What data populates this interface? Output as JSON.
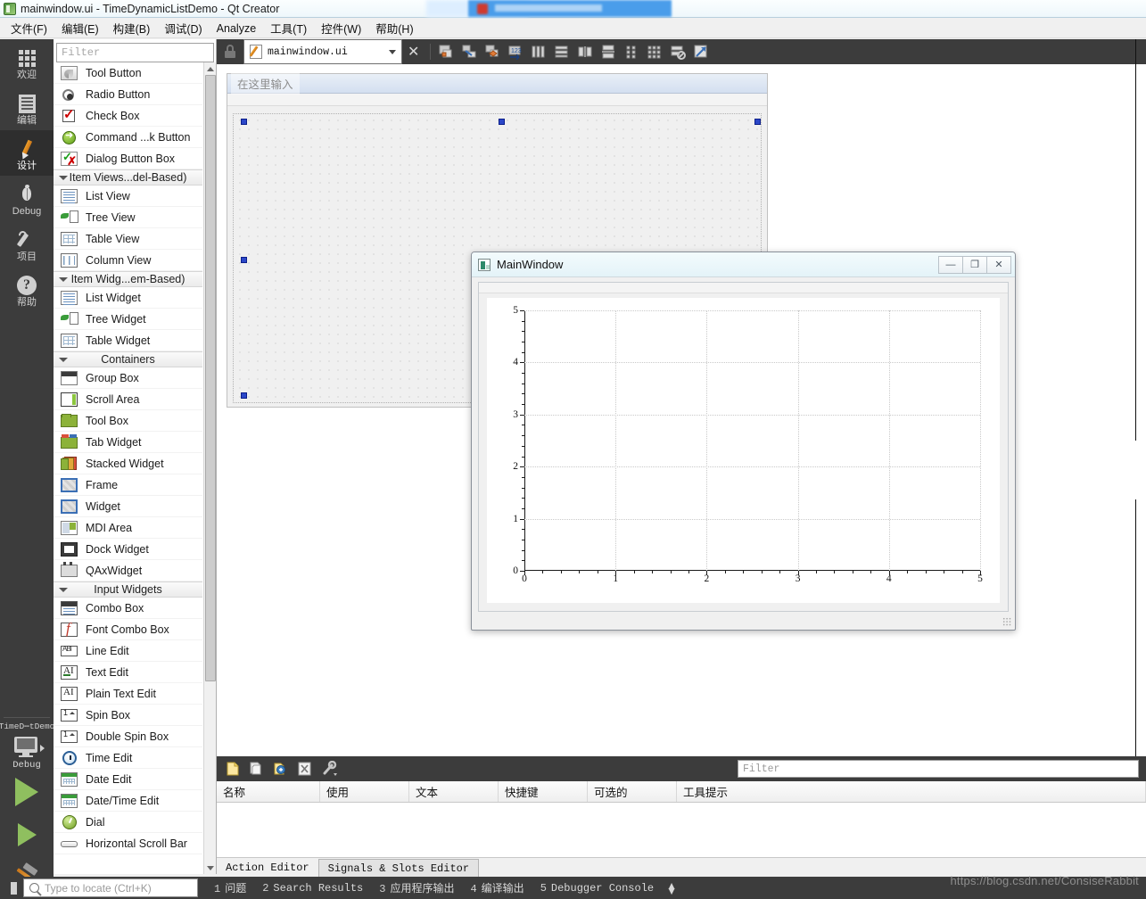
{
  "window": {
    "title": "mainwindow.ui - TimeDynamicListDemo - Qt Creator",
    "icon": "qtcreator-icon"
  },
  "menubar": {
    "items": [
      {
        "label": "文件(F)",
        "name": "menu-file"
      },
      {
        "label": "编辑(E)",
        "name": "menu-edit"
      },
      {
        "label": "构建(B)",
        "name": "menu-build"
      },
      {
        "label": "调试(D)",
        "name": "menu-debug"
      },
      {
        "label": "Analyze",
        "name": "menu-analyze"
      },
      {
        "label": "工具(T)",
        "name": "menu-tools"
      },
      {
        "label": "控件(W)",
        "name": "menu-window"
      },
      {
        "label": "帮助(H)",
        "name": "menu-help"
      }
    ]
  },
  "modebar": {
    "modes": [
      {
        "label": "欢迎",
        "icon": "grid-icon",
        "active": false
      },
      {
        "label": "编辑",
        "icon": "document-icon",
        "active": false
      },
      {
        "label": "设计",
        "icon": "pencil-icon",
        "active": true
      },
      {
        "label": "Debug",
        "icon": "bug-icon",
        "active": false
      },
      {
        "label": "项目",
        "icon": "wrench-icon",
        "active": false
      },
      {
        "label": "帮助",
        "icon": "question-icon",
        "active": false
      }
    ],
    "kit": {
      "project": "TimeD⋯tDemo",
      "build_config": "Debug",
      "icon": "monitor-icon"
    },
    "run_button": "run-icon",
    "debug_button": "debug-run-icon",
    "build_button": "hammer-icon"
  },
  "widget_box": {
    "filter_placeholder": "Filter",
    "groups": [
      {
        "items": [
          {
            "label": "Tool Button",
            "icon": "tool-button-icon"
          },
          {
            "label": "Radio Button",
            "icon": "radio-button-icon"
          },
          {
            "label": "Check Box",
            "icon": "check-box-icon"
          },
          {
            "label": "Command ...k Button",
            "icon": "command-link-button-icon"
          },
          {
            "label": "Dialog Button Box",
            "icon": "dialog-button-box-icon"
          }
        ]
      },
      {
        "title": "Item Views...del-Based)",
        "items": [
          {
            "label": "List View",
            "icon": "list-view-icon"
          },
          {
            "label": "Tree View",
            "icon": "tree-view-icon"
          },
          {
            "label": "Table View",
            "icon": "table-view-icon"
          },
          {
            "label": "Column View",
            "icon": "column-view-icon"
          }
        ]
      },
      {
        "title": "Item Widg...em-Based)",
        "items": [
          {
            "label": "List Widget",
            "icon": "list-widget-icon"
          },
          {
            "label": "Tree Widget",
            "icon": "tree-widget-icon"
          },
          {
            "label": "Table Widget",
            "icon": "table-widget-icon"
          }
        ]
      },
      {
        "title": "Containers",
        "items": [
          {
            "label": "Group Box",
            "icon": "group-box-icon"
          },
          {
            "label": "Scroll Area",
            "icon": "scroll-area-icon"
          },
          {
            "label": "Tool Box",
            "icon": "tool-box-icon"
          },
          {
            "label": "Tab Widget",
            "icon": "tab-widget-icon"
          },
          {
            "label": "Stacked Widget",
            "icon": "stacked-widget-icon"
          },
          {
            "label": "Frame",
            "icon": "frame-icon"
          },
          {
            "label": "Widget",
            "icon": "widget-icon"
          },
          {
            "label": "MDI Area",
            "icon": "mdi-area-icon"
          },
          {
            "label": "Dock Widget",
            "icon": "dock-widget-icon"
          },
          {
            "label": "QAxWidget",
            "icon": "qax-widget-icon"
          }
        ]
      },
      {
        "title": "Input Widgets",
        "items": [
          {
            "label": "Combo Box",
            "icon": "combo-box-icon"
          },
          {
            "label": "Font Combo Box",
            "icon": "font-combo-box-icon"
          },
          {
            "label": "Line Edit",
            "icon": "line-edit-icon"
          },
          {
            "label": "Text Edit",
            "icon": "text-edit-icon"
          },
          {
            "label": "Plain Text Edit",
            "icon": "plain-text-edit-icon"
          },
          {
            "label": "Spin Box",
            "icon": "spin-box-icon"
          },
          {
            "label": "Double Spin Box",
            "icon": "double-spin-box-icon"
          },
          {
            "label": "Time Edit",
            "icon": "time-edit-icon"
          },
          {
            "label": "Date Edit",
            "icon": "date-edit-icon"
          },
          {
            "label": "Date/Time Edit",
            "icon": "date-time-edit-icon"
          },
          {
            "label": "Dial",
            "icon": "dial-icon"
          },
          {
            "label": "Horizontal Scroll Bar",
            "icon": "horizontal-scroll-bar-icon"
          }
        ]
      }
    ]
  },
  "designer_toolbar": {
    "open_file": "mainwindow.ui",
    "close_label": "✕",
    "buttons": [
      {
        "name": "edit-widgets-icon"
      },
      {
        "name": "edit-signals-slots-icon"
      },
      {
        "name": "edit-buddies-icon"
      },
      {
        "name": "edit-tab-order-icon"
      },
      {
        "name": "layout-horizontally-icon"
      },
      {
        "name": "layout-vertically-icon"
      },
      {
        "name": "layout-horizontally-splitter-icon"
      },
      {
        "name": "layout-vertically-splitter-icon"
      },
      {
        "name": "layout-in-form-icon"
      },
      {
        "name": "layout-grid-icon"
      },
      {
        "name": "break-layout-icon"
      },
      {
        "name": "adjust-size-icon"
      }
    ]
  },
  "form_editor": {
    "menubar_placeholder": "在这里输入"
  },
  "preview_window": {
    "title": "MainWindow",
    "buttons": [
      {
        "label": "—",
        "name": "minimize-button"
      },
      {
        "label": "❐",
        "name": "maximize-button"
      },
      {
        "label": "✕",
        "name": "close-button"
      }
    ]
  },
  "chart_data": {
    "type": "line",
    "title": "",
    "xlabel": "",
    "ylabel": "",
    "xlim": [
      0,
      5
    ],
    "ylim": [
      0,
      5
    ],
    "xticks": [
      0,
      1,
      2,
      3,
      4,
      5
    ],
    "yticks": [
      0,
      1,
      2,
      3,
      4,
      5
    ],
    "xtick_labels": [
      "0",
      "1",
      "2",
      "3",
      "4",
      "5"
    ],
    "ytick_labels": [
      "0",
      "1",
      "2",
      "3",
      "4",
      "5"
    ],
    "grid": true,
    "grid_style": "dotted",
    "legend": null,
    "series": [
      {
        "name": "",
        "x": [],
        "y": []
      }
    ],
    "note": "empty QCustomPlot / chart canvas - no data plotted"
  },
  "action_editor": {
    "filter_placeholder": "Filter",
    "toolbar_buttons": [
      {
        "name": "new-action-icon"
      },
      {
        "name": "copy-action-icon"
      },
      {
        "name": "edit-action-icon"
      },
      {
        "name": "delete-action-icon"
      },
      {
        "name": "configure-icon"
      }
    ],
    "columns": [
      "名称",
      "使用",
      "文本",
      "快捷键",
      "可选的",
      "工具提示"
    ],
    "rows": []
  },
  "bottom_tabs": [
    {
      "label": "Action Editor",
      "active": false
    },
    {
      "label": "Signals & Slots Editor",
      "active": true
    }
  ],
  "statusbar": {
    "locator_placeholder": "Type to locate (Ctrl+K)",
    "output_tabs": [
      {
        "num": "1",
        "label": "问题"
      },
      {
        "num": "2",
        "label": "Search Results"
      },
      {
        "num": "3",
        "label": "应用程序输出"
      },
      {
        "num": "4",
        "label": "编译输出"
      },
      {
        "num": "5",
        "label": "Debugger Console"
      }
    ]
  },
  "watermark": "https://blog.csdn.net/ConsiseRabbit",
  "colors": {
    "accent": "#2b47c8",
    "dark_chrome": "#3c3c3c",
    "titlebar": "#eef7fb",
    "selection": "#4a9dea"
  }
}
